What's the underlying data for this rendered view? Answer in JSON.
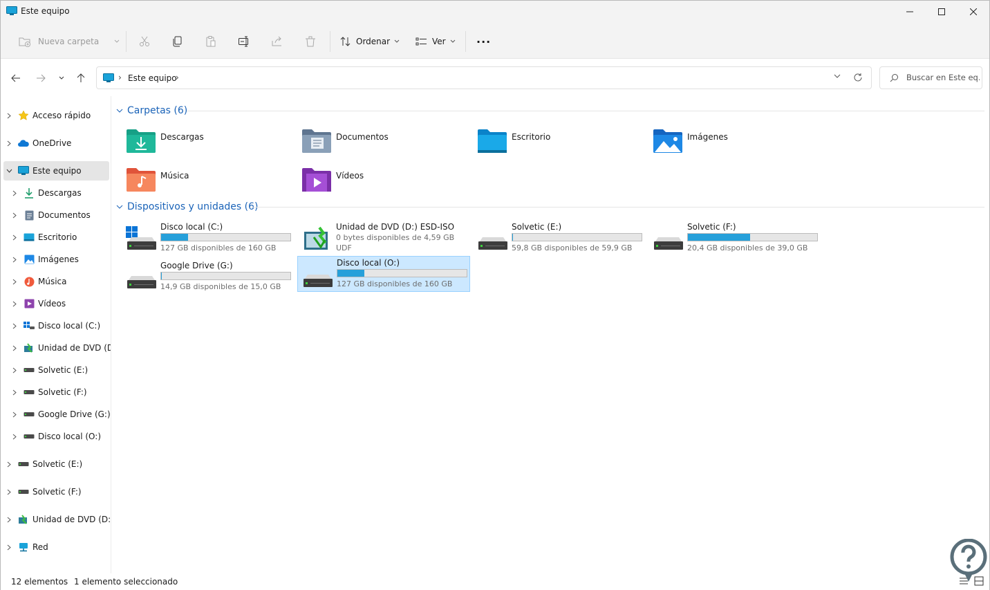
{
  "window": {
    "title": "Este equipo"
  },
  "toolbar": {
    "new_folder": "Nueva carpeta",
    "sort": "Ordenar",
    "view": "Ver",
    "more": "···"
  },
  "address": {
    "crumb": "Este equipo",
    "search_placeholder": "Buscar en Este eq..."
  },
  "sidebar": {
    "items": [
      {
        "label": "Acceso rápido",
        "icon": "star-icon"
      },
      {
        "label": "OneDrive",
        "icon": "cloud-icon"
      },
      {
        "label": "Este equipo",
        "icon": "pc-icon"
      },
      {
        "label": "Descargas",
        "icon": "download-icon"
      },
      {
        "label": "Documentos",
        "icon": "document-icon"
      },
      {
        "label": "Escritorio",
        "icon": "desktop-icon"
      },
      {
        "label": "Imágenes",
        "icon": "image-icon"
      },
      {
        "label": "Música",
        "icon": "music-icon"
      },
      {
        "label": "Vídeos",
        "icon": "video-icon"
      },
      {
        "label": "Disco local (C:)",
        "icon": "windows-drive-icon"
      },
      {
        "label": "Unidad de DVD (D:)",
        "icon": "dvd-icon"
      },
      {
        "label": "Solvetic (E:)",
        "icon": "drive-icon"
      },
      {
        "label": "Solvetic (F:)",
        "icon": "drive-icon"
      },
      {
        "label": "Google Drive (G:)",
        "icon": "drive-icon"
      },
      {
        "label": "Disco local (O:)",
        "icon": "drive-icon"
      },
      {
        "label": "Solvetic (E:)",
        "icon": "drive-icon"
      },
      {
        "label": "Solvetic (F:)",
        "icon": "drive-icon"
      },
      {
        "label": "Unidad de DVD (D:)",
        "icon": "dvd-icon"
      },
      {
        "label": "Red",
        "icon": "network-icon"
      }
    ]
  },
  "folders": {
    "header": "Carpetas (6)",
    "items": [
      {
        "label": "Descargas",
        "icon": "downloads-folder-icon"
      },
      {
        "label": "Documentos",
        "icon": "documents-folder-icon"
      },
      {
        "label": "Escritorio",
        "icon": "desktop-folder-icon"
      },
      {
        "label": "Imágenes",
        "icon": "pictures-folder-icon"
      },
      {
        "label": "Música",
        "icon": "music-folder-icon"
      },
      {
        "label": "Vídeos",
        "icon": "videos-folder-icon"
      }
    ]
  },
  "drives": {
    "header": "Dispositivos y unidades (6)",
    "items": [
      {
        "label": "Disco local (C:)",
        "free": "127 GB disponibles de 160 GB",
        "used_fraction": 0.21,
        "icon": "windows-drive-icon"
      },
      {
        "label": "Unidad de DVD (D:) ESD-ISO",
        "free": "0 bytes disponibles de 4,59 GB",
        "fs": "UDF",
        "icon": "dvd-drive-icon"
      },
      {
        "label": "Solvetic (E:)",
        "free": "59,8 GB disponibles de 59,9 GB",
        "used_fraction": 0.002,
        "icon": "drive-icon"
      },
      {
        "label": "Solvetic (F:)",
        "free": "20,4 GB disponibles de 39,0 GB",
        "used_fraction": 0.48,
        "icon": "drive-icon"
      },
      {
        "label": "Google Drive (G:)",
        "free": "14,9 GB disponibles de 15,0 GB",
        "used_fraction": 0.007,
        "icon": "drive-icon"
      },
      {
        "label": "Disco local (O:)",
        "free": "127 GB disponibles de 160 GB",
        "used_fraction": 0.21,
        "icon": "drive-icon",
        "selected": true
      }
    ]
  },
  "status": {
    "count": "12 elementos",
    "selected": "1 elemento seleccionado"
  },
  "colors": {
    "accent": "#1a63b8",
    "bar_fill": "#26a0da",
    "selection": "#cce8ff"
  }
}
